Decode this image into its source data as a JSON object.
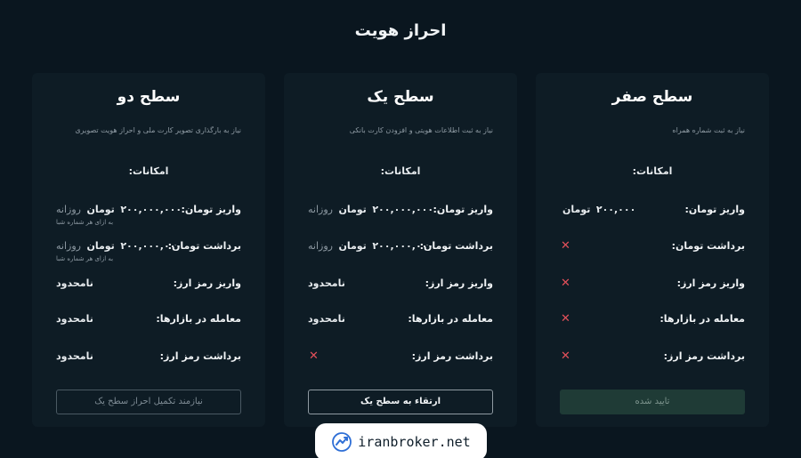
{
  "page": {
    "title": "احراز هویت"
  },
  "cards": [
    {
      "title": "سطح صفر",
      "description": "نیاز به ثبت شماره همراه",
      "features_title": "امکانات:",
      "rows": [
        {
          "label": "واریز تومان:",
          "amount": "۲۰۰,۰۰۰",
          "unit": "تومان",
          "period": "",
          "note": ""
        },
        {
          "label": "برداشت تومان:",
          "cross": "✕"
        },
        {
          "label": "واریز رمز ارز:",
          "cross": "✕"
        },
        {
          "label": "معامله در بازارها:",
          "cross": "✕"
        },
        {
          "label": "برداشت رمز ارز:",
          "cross": "✕"
        }
      ],
      "button": "تایید شده"
    },
    {
      "title": "سطح یک",
      "description": "نیاز به ثبت اطلاعات هویتی و افزودن کارت بانکی",
      "features_title": "امکانات:",
      "rows": [
        {
          "label": "واریز تومان:",
          "amount": "۲۰۰,۰۰۰,۰۰۰",
          "unit": "تومان",
          "period": "روزانه",
          "note": ""
        },
        {
          "label": "برداشت تومان:",
          "amount": "۲۰۰,۰۰۰,۰۰۰",
          "unit": "تومان",
          "period": "روزانه",
          "note": ""
        },
        {
          "label": "واریز رمز ارز:",
          "text": "نامحدود"
        },
        {
          "label": "معامله در بازارها:",
          "text": "نامحدود"
        },
        {
          "label": "برداشت رمز ارز:",
          "cross": "✕"
        }
      ],
      "button": "ارتقاء به سطح یک"
    },
    {
      "title": "سطح دو",
      "description": "نیاز به بارگذاری تصویر کارت ملی و احراز هویت تصویری",
      "features_title": "امکانات:",
      "rows": [
        {
          "label": "واریز تومان:",
          "amount": "۲۰۰,۰۰۰,۰۰۰",
          "unit": "تومان",
          "period": "روزانه",
          "note": "به ازای هر شماره شبا"
        },
        {
          "label": "برداشت تومان:",
          "amount": "۲۰۰,۰۰۰,۰۰۰",
          "unit": "تومان",
          "period": "روزانه",
          "note": "به ازای هر شماره شبا"
        },
        {
          "label": "واریز رمز ارز:",
          "text": "نامحدود"
        },
        {
          "label": "معامله در بازارها:",
          "text": "نامحدود"
        },
        {
          "label": "برداشت رمز ارز:",
          "text": "نامحدود"
        }
      ],
      "button": "نیازمند تکمیل احراز سطح یک"
    }
  ],
  "watermark": {
    "text": "iranbroker.net"
  },
  "colors": {
    "background": "#0a161f",
    "card": "#0e1c25",
    "cross": "#e3505a",
    "verified_bg": "#1f3b36",
    "logo_blue": "#2f6fd6"
  }
}
